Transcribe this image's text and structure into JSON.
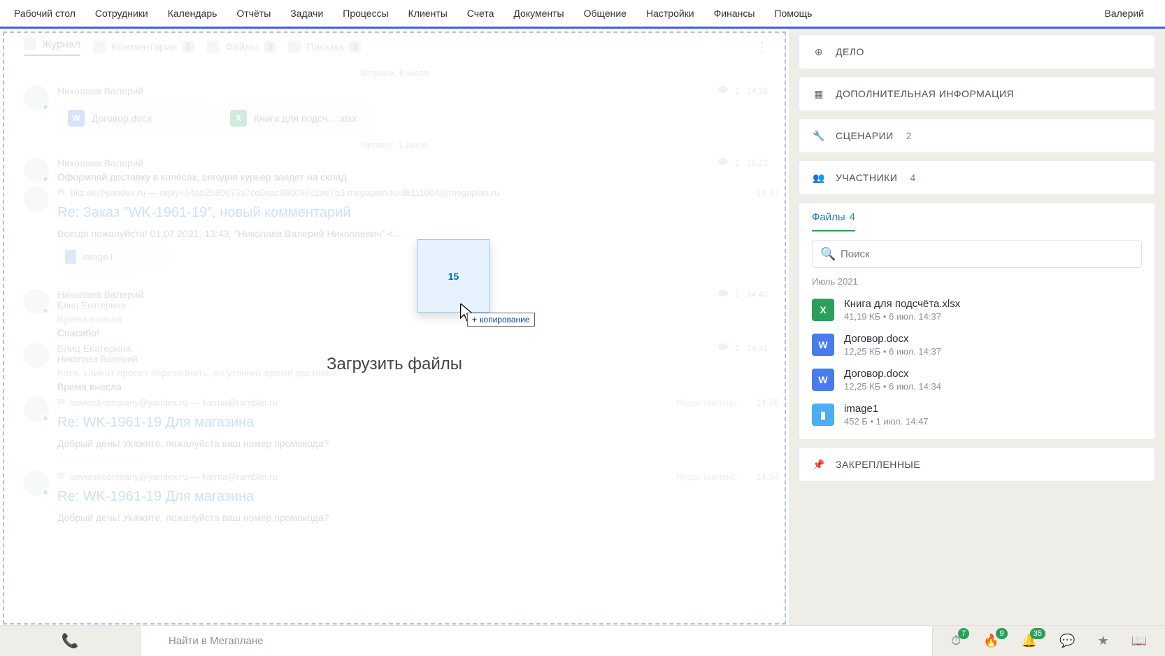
{
  "nav": {
    "items": [
      "Рабочий стол",
      "Сотрудники",
      "Календарь",
      "Отчёты",
      "Задачи",
      "Процессы",
      "Клиенты",
      "Счета",
      "Документы",
      "Общение",
      "Настройки",
      "Финансы",
      "Помощь"
    ],
    "user": "Валерий"
  },
  "tabs": {
    "journal": "Журнал",
    "comments": "Комментарии",
    "comments_count": "5",
    "files": "Файлы",
    "files_count": "3",
    "letters": "Письма",
    "letters_count": "3"
  },
  "drop": {
    "title": "Загрузить файлы",
    "file_label": "15",
    "hint": "копирование"
  },
  "dates": {
    "tue": "Вторник, 6 июля",
    "thu": "Четверг, 1 июля"
  },
  "msgs": {
    "nv": "Николаев Валерий",
    "be": "Блиц Екатерина",
    "m1_views": "1",
    "m1_time": "14:38",
    "att1": "Договор.docx",
    "att2": "Книга для подсч….xlsx",
    "m2_text": "Оформляй доставку в колёсах, сегодня курьер заедет на склад",
    "m2_views": "2",
    "m2_time": "15:12",
    "em1_from": "bliz.ek@yandex.ru — reply+54ab2580075a7cd0eac680097c2ae7b3.megaplan.to-38111004@megaplan.ru",
    "em1_time": "14:47",
    "em1_subject": "Re: Заказ \"WK-1961-19\", новый комментарий",
    "em1_body": "Всегда пожалуйста!   01.07.2021, 13:43, \"Николаев Валерий Николаевич\" <...",
    "em1_att": "image1",
    "m3_text1": "Время внесла",
    "m3_text2": "Спасибо!",
    "m3_views": "1",
    "m3_time": "14:42",
    "m4_text1": "Катя, клиент просит перезвонить, он уточнит время доставки",
    "m4_text2": "Время внесла",
    "m4_views": "2",
    "m4_time": "14:41",
    "em2_from": "severskcompany@yandex.ru — karma@rambler.ru",
    "em2_status": "Недоставлено",
    "em2_time": "14:36",
    "em2_subject": "Re: WK-1961-19 Для магазина",
    "em2_body": "Добрый день! Укажите, пожалуйста ваш номер промокода?",
    "em3_from": "severskcompany@yandex.ru — karma@rambler.ru",
    "em3_status": "Недоставлено",
    "em3_time": "14:34",
    "em3_subject": "Re: WK-1961-19 Для магазина",
    "em3_body": "Добрый день! Укажите, пожалуйста ваш номер промокода?"
  },
  "right": {
    "case": "ДЕЛО",
    "extra": "ДОПОЛНИТЕЛЬНАЯ ИНФОРМАЦИЯ",
    "scen": "СЦЕНАРИИ",
    "scen_count": "2",
    "part": "УЧАСТНИКИ",
    "part_count": "4",
    "pinned": "ЗАКРЕПЛЕННЫЕ",
    "files_tab": "Файлы",
    "files_count": "4",
    "search_ph": "Поиск",
    "group": "Июль 2021",
    "f1_name": "Книга для подсчёта.xlsx",
    "f1_meta": "41,19 КБ • 6 июл. 14:37",
    "f2_name": "Договор.docx",
    "f2_meta": "12,25 КБ • 6 июл. 14:37",
    "f3_name": "Договор.docx",
    "f3_meta": "12,25 КБ • 6 июл. 14:34",
    "f4_name": "image1",
    "f4_meta": "452 Б • 1 июл. 14:47"
  },
  "bottom": {
    "search_ph": "Найти в Мегаплане",
    "b1": "7",
    "b2": "9",
    "b3": "35"
  }
}
